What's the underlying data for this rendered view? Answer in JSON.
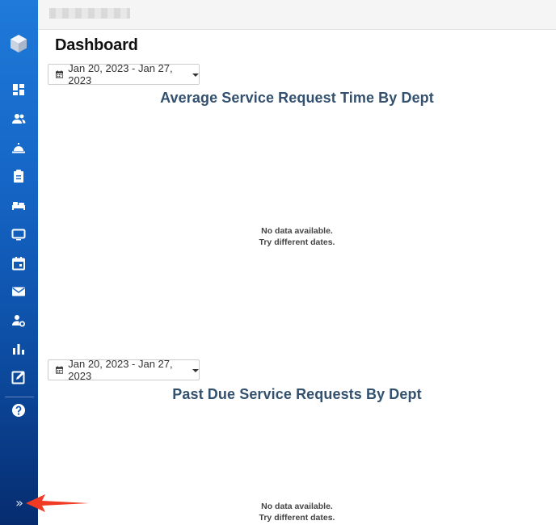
{
  "header": {
    "title": "Dashboard"
  },
  "sidebar": {
    "items": [
      {
        "icon": "dashboard-icon"
      },
      {
        "icon": "users-icon"
      },
      {
        "icon": "service-bell-icon"
      },
      {
        "icon": "clipboard-icon"
      },
      {
        "icon": "bed-icon"
      },
      {
        "icon": "tv-icon"
      },
      {
        "icon": "calendar-icon"
      },
      {
        "icon": "envelope-icon"
      },
      {
        "icon": "user-settings-icon"
      },
      {
        "icon": "bar-chart-icon"
      },
      {
        "icon": "edit-icon"
      },
      {
        "icon": "help-icon"
      }
    ],
    "expand_label": "»"
  },
  "panels": [
    {
      "date_range": "Jan 20, 2023 - Jan 27, 2023",
      "title": "Average Service Request Time By Dept",
      "empty_line1": "No data available.",
      "empty_line2": "Try different dates."
    },
    {
      "date_range": "Jan 20, 2023 - Jan 27, 2023",
      "title": "Past Due Service Requests By Dept",
      "empty_line1": "No data available.",
      "empty_line2": "Try different dates."
    }
  ],
  "colors": {
    "sidebar_top": "#1f7ad9",
    "sidebar_bottom": "#062c6f",
    "chart_title": "#33506e",
    "arrow": "#f03a24"
  }
}
